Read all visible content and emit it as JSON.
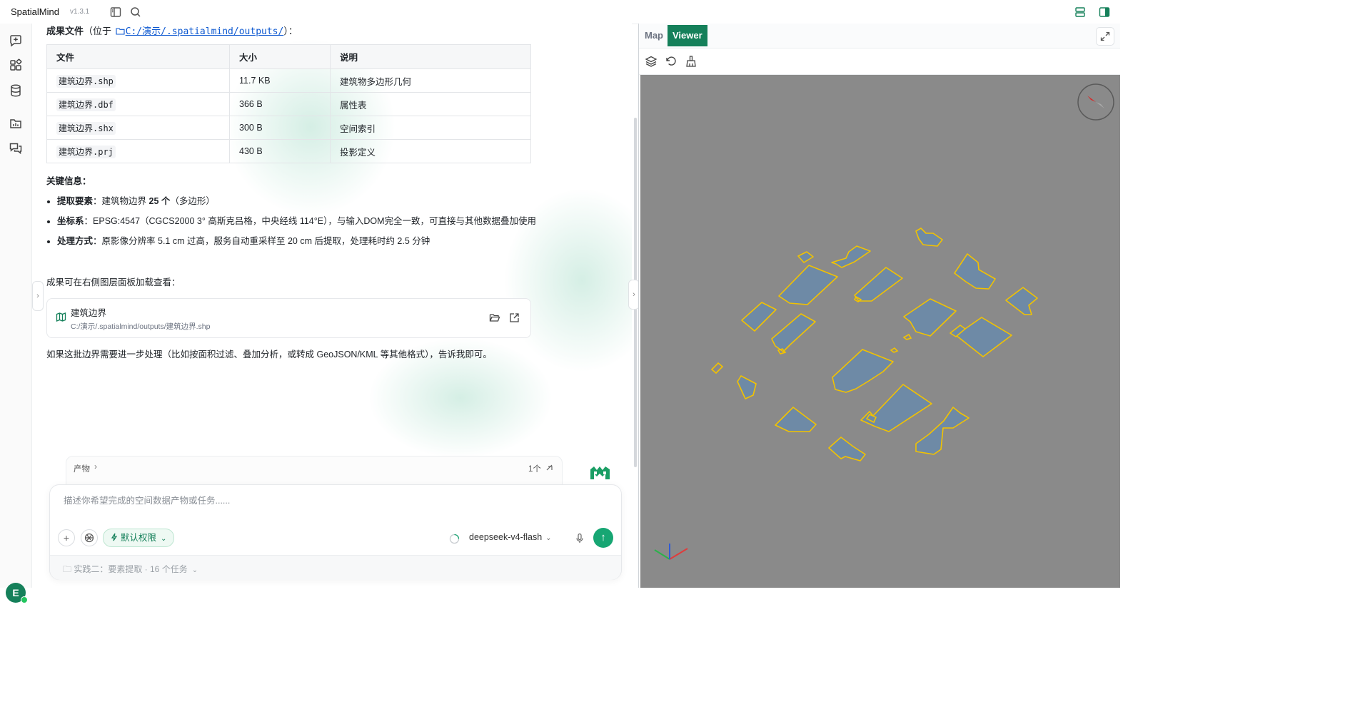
{
  "app": {
    "title": "SpatialMind",
    "version": "v1.3.1"
  },
  "results": {
    "heading_label": "成果文件",
    "heading_prefix": "（位于",
    "heading_suffix": "）：",
    "output_path": "C:/演示/.spatialmind/outputs/"
  },
  "table": {
    "headers": [
      "文件",
      "大小",
      "说明"
    ],
    "rows": [
      {
        "file": "建筑边界.shp",
        "size": "11.7 KB",
        "desc": "建筑物多边形几何"
      },
      {
        "file": "建筑边界.dbf",
        "size": "366 B",
        "desc": "属性表"
      },
      {
        "file": "建筑边界.shx",
        "size": "300 B",
        "desc": "空间索引"
      },
      {
        "file": "建筑边界.prj",
        "size": "430 B",
        "desc": "投影定义"
      }
    ]
  },
  "key_info": {
    "heading": "关键信息：",
    "items": [
      {
        "label": "提取要素",
        "pre": "：建筑物边界 ",
        "strong": "25 个",
        "post": "（多边形）"
      },
      {
        "label": "坐标系",
        "text": "：EPSG:4547（CGCS2000 3° 高斯克吕格，中央经线 114°E），与输入DOM完全一致，可直接与其他数据叠加使用"
      },
      {
        "label": "处理方式",
        "text": "：原影像分辨率 5.1 cm 过高，服务自动重采样至 20 cm 后提取，处理耗时约 2.5 分钟"
      }
    ]
  },
  "viewer_hint": "成果可在右侧图层面板加载查看：",
  "layer_card": {
    "name": "建筑边界",
    "path": "C:/演示/.spatialmind/outputs/建筑边界.shp"
  },
  "followup": "如果这批边界需要进一步处理（比如按面积过滤、叠加分析，或转成 GeoJSON/KML 等其他格式），告诉我即可。",
  "artifacts": {
    "label": "产物",
    "count": "1个"
  },
  "composer": {
    "placeholder": "描述你希望完成的空间数据产物或任务......",
    "permission": "默认权限",
    "model": "deepseek-v4-flash"
  },
  "workspace": {
    "info": "实践二：要素提取 · 16 个任务"
  },
  "panel": {
    "tabs": [
      "Map",
      "Viewer"
    ],
    "active_tab": "Viewer"
  },
  "user": {
    "initial": "E"
  },
  "colors": {
    "accent": "#15805a",
    "send": "#17a673",
    "building_fill": "#6e8aa6",
    "building_outline": "#f2c200",
    "viewport_bg": "#8a8a8a"
  }
}
